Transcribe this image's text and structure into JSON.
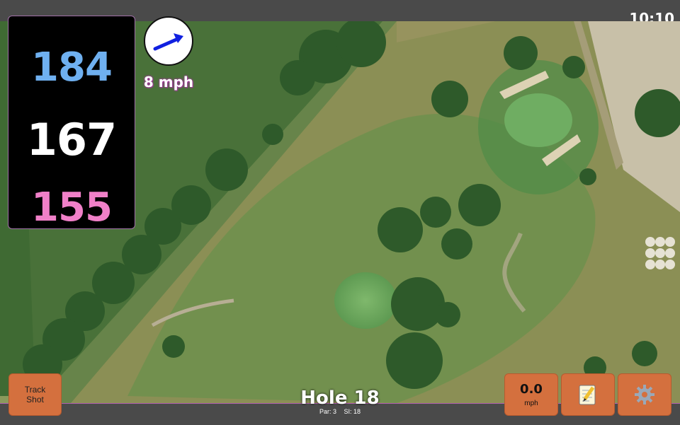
{
  "status_bar": {
    "time": "10:10"
  },
  "distances": {
    "back": {
      "value": "184",
      "color": "#6fb0f0"
    },
    "middle": {
      "value": "167",
      "color": "#ffffff"
    },
    "front": {
      "value": "155",
      "color": "#f080c8"
    }
  },
  "wind": {
    "speed_label": "8 mph",
    "direction_icon": "arrow-icon"
  },
  "hole": {
    "title": "Hole 18",
    "par_label": "Par: 3",
    "si_label": "SI: 18"
  },
  "buttons": {
    "track_shot_line1": "Track",
    "track_shot_line2": "Shot",
    "speed_value": "0.0",
    "speed_unit": "mph",
    "notes_icon": "notepad-icon",
    "settings_icon": "gear-icon"
  },
  "colors": {
    "accent": "#d4703e",
    "border": "#b05fb0"
  }
}
